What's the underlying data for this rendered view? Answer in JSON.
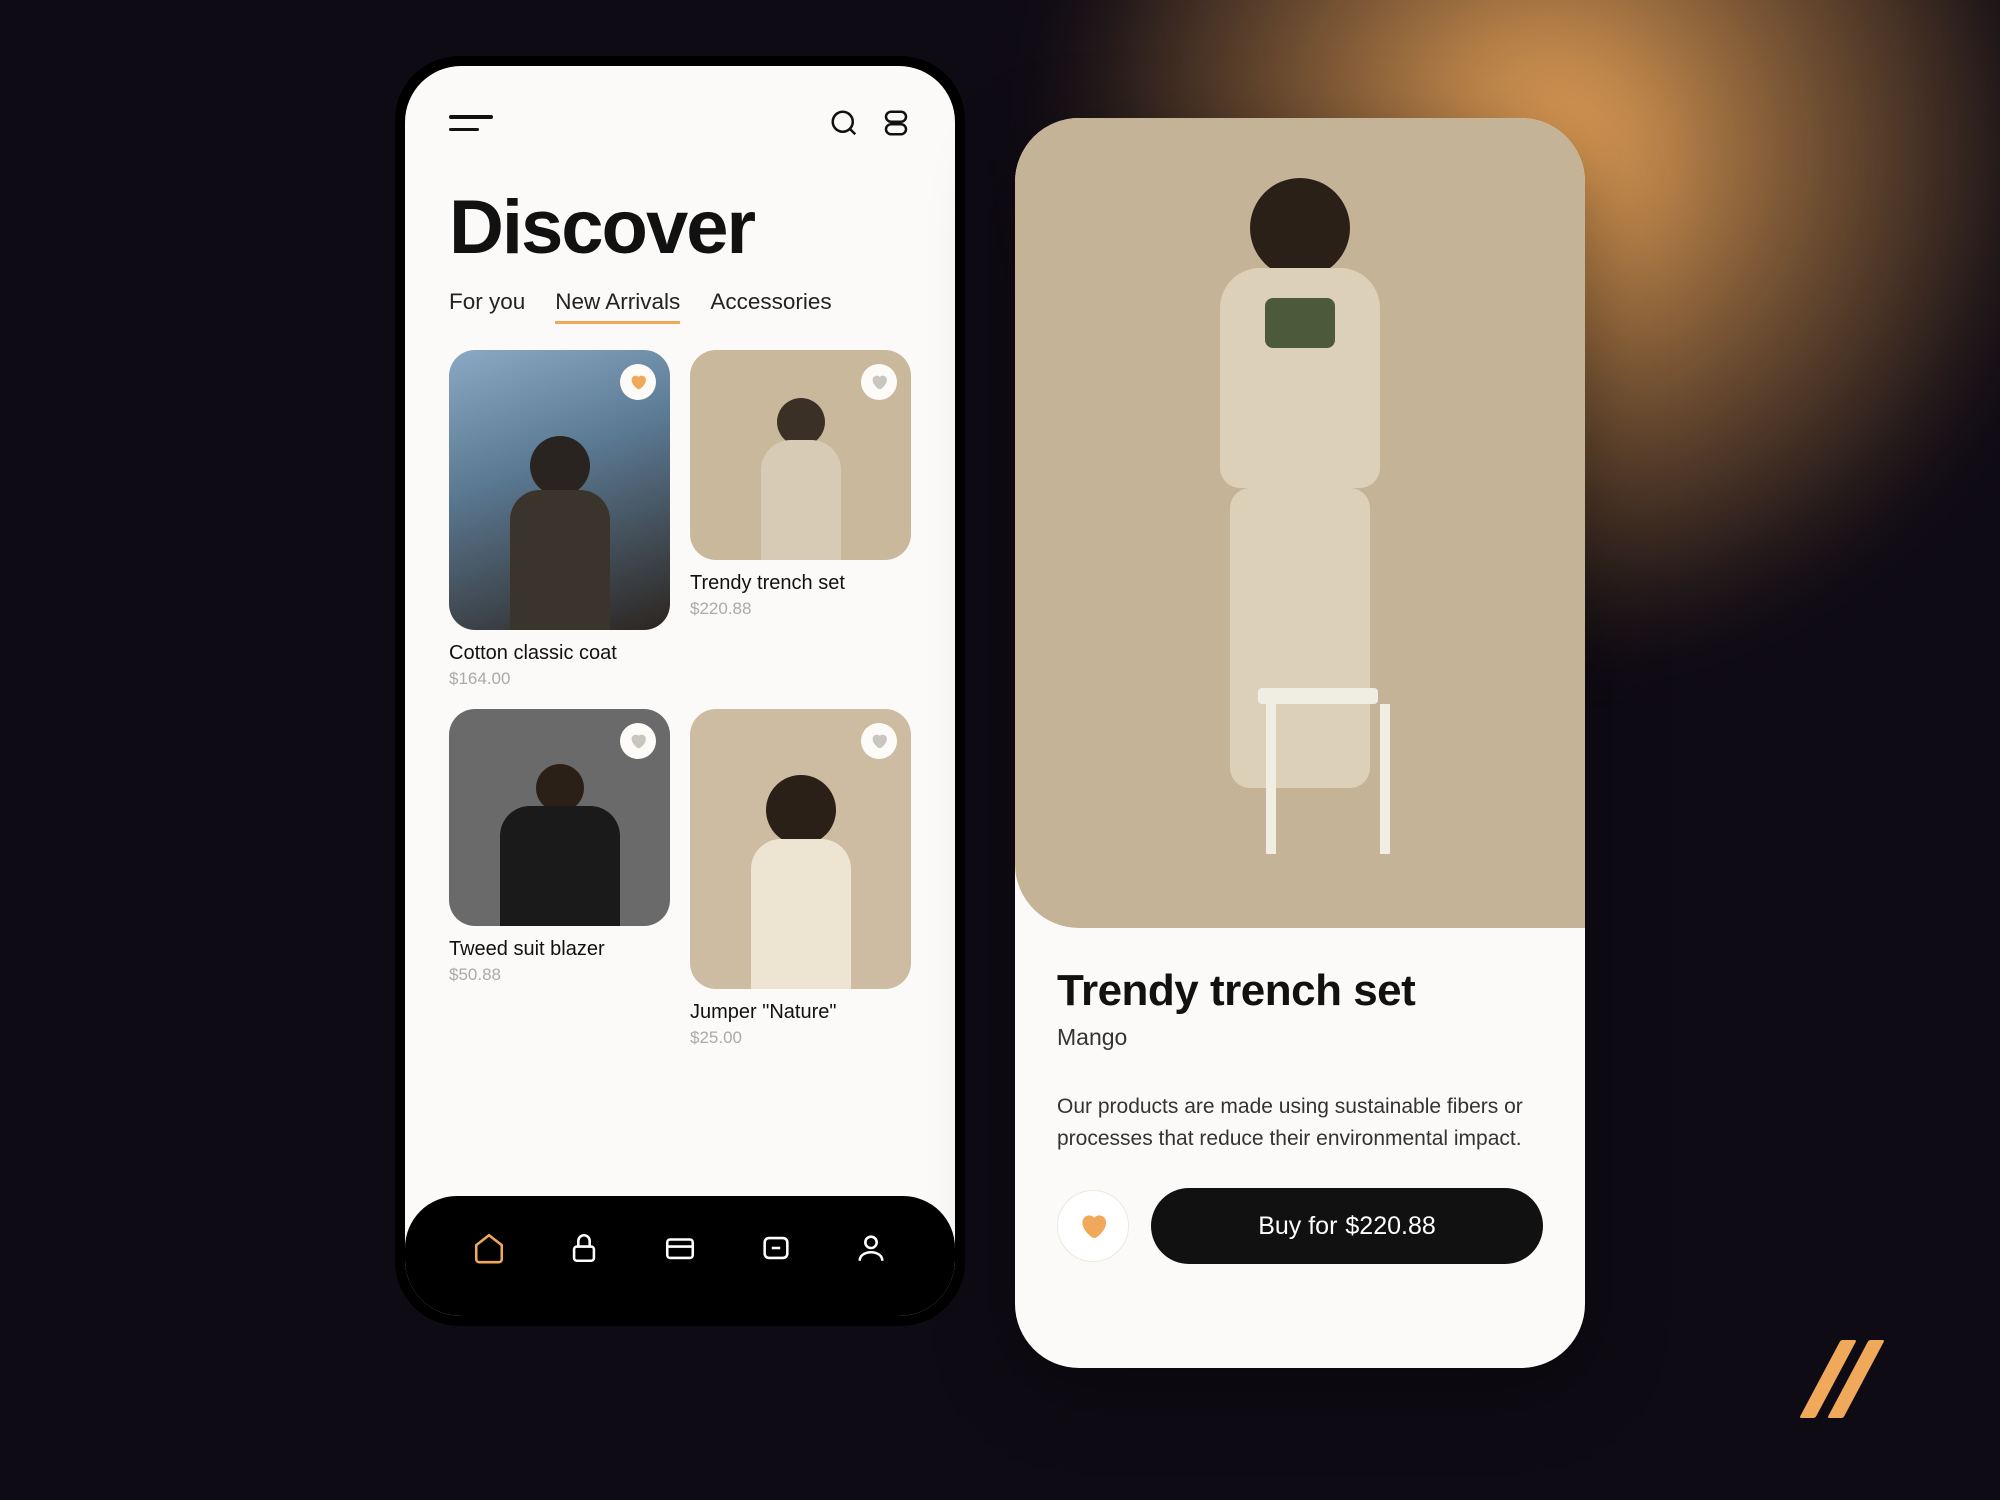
{
  "colors": {
    "accent": "#f0a95a",
    "bg": "#0f0b14"
  },
  "discover": {
    "title": "Discover",
    "tabs": [
      {
        "label": "For you",
        "active": false
      },
      {
        "label": "New Arrivals",
        "active": true
      },
      {
        "label": "Accessories",
        "active": false
      }
    ],
    "products": [
      {
        "name": "Cotton classic coat",
        "price": "$164.00",
        "favorited": true
      },
      {
        "name": "Trendy trench set",
        "price": "$220.88",
        "favorited": false
      },
      {
        "name": "Tweed suit blazer",
        "price": "$50.88",
        "favorited": false
      },
      {
        "name": "Jumper \"Nature\"",
        "price": "$25.00",
        "favorited": false
      }
    ],
    "nav": [
      {
        "icon": "home",
        "active": true
      },
      {
        "icon": "lock",
        "active": false
      },
      {
        "icon": "card",
        "active": false
      },
      {
        "icon": "chat",
        "active": false
      },
      {
        "icon": "profile",
        "active": false
      }
    ]
  },
  "detail": {
    "title": "Trendy trench set",
    "brand": "Mango",
    "description": "Our products are made using sustainable fibers or processes that reduce their environmental impact.",
    "favorited": true,
    "buy_prefix": "Buy for ",
    "price": "$220.88"
  }
}
